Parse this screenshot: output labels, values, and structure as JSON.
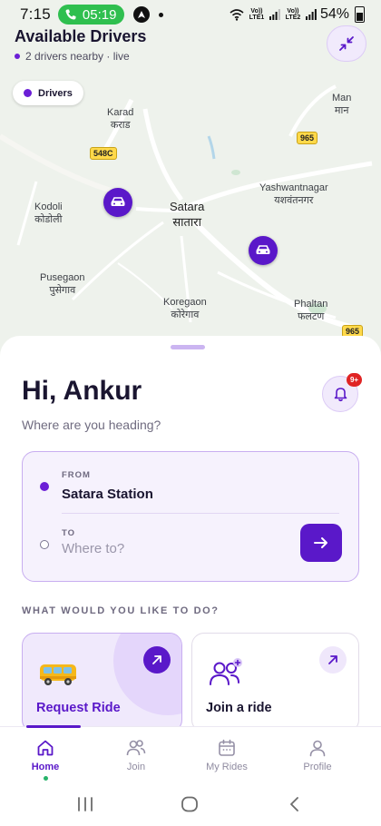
{
  "status_bar": {
    "time": "7:15",
    "call_timer": "05:19",
    "network_1": "Vo)) LTE1",
    "network_2": "Vo)) LTE2",
    "battery": "54%"
  },
  "map": {
    "title": "Available Drivers",
    "subtitle": "2 drivers nearby · live",
    "legend_label": "Drivers",
    "places": [
      {
        "name": "Karad",
        "local": "कराड"
      },
      {
        "name": "Man",
        "local": "मान"
      },
      {
        "name": "Yashwantnagar",
        "local": "यशवंतनगर"
      },
      {
        "name": "Kodoli",
        "local": "कोडोली"
      },
      {
        "name": "Satara",
        "local": "सातारा"
      },
      {
        "name": "Pusegaon",
        "local": "पुसेगाव"
      },
      {
        "name": "Koregaon",
        "local": "कोरेगाव"
      },
      {
        "name": "Phaltan",
        "local": "फलटण"
      }
    ],
    "road_shields": [
      "548C",
      "965",
      "965"
    ],
    "driver_count": 2
  },
  "home": {
    "greeting": "Hi, Ankur",
    "prompt": "Where are you heading?",
    "notification_badge": "9+",
    "from_label": "FROM",
    "from_value": "Satara Station",
    "to_label": "TO",
    "to_placeholder": "Where to?",
    "section_title": "WHAT WOULD YOU LIKE TO DO?",
    "actions": [
      {
        "label": "Request Ride"
      },
      {
        "label": "Join a ride"
      }
    ]
  },
  "nav": {
    "items": [
      {
        "label": "Home",
        "icon": "home-icon",
        "active": true
      },
      {
        "label": "Join",
        "icon": "users-icon",
        "active": false
      },
      {
        "label": "My Rides",
        "icon": "calendar-icon",
        "active": false
      },
      {
        "label": "Profile",
        "icon": "user-icon",
        "active": false
      }
    ]
  },
  "colors": {
    "accent": "#5a18c9",
    "accent_light": "#f1eafc",
    "badge": "#e02424",
    "call_green": "#2fbf4f",
    "map_bg": "#eef2ec"
  }
}
